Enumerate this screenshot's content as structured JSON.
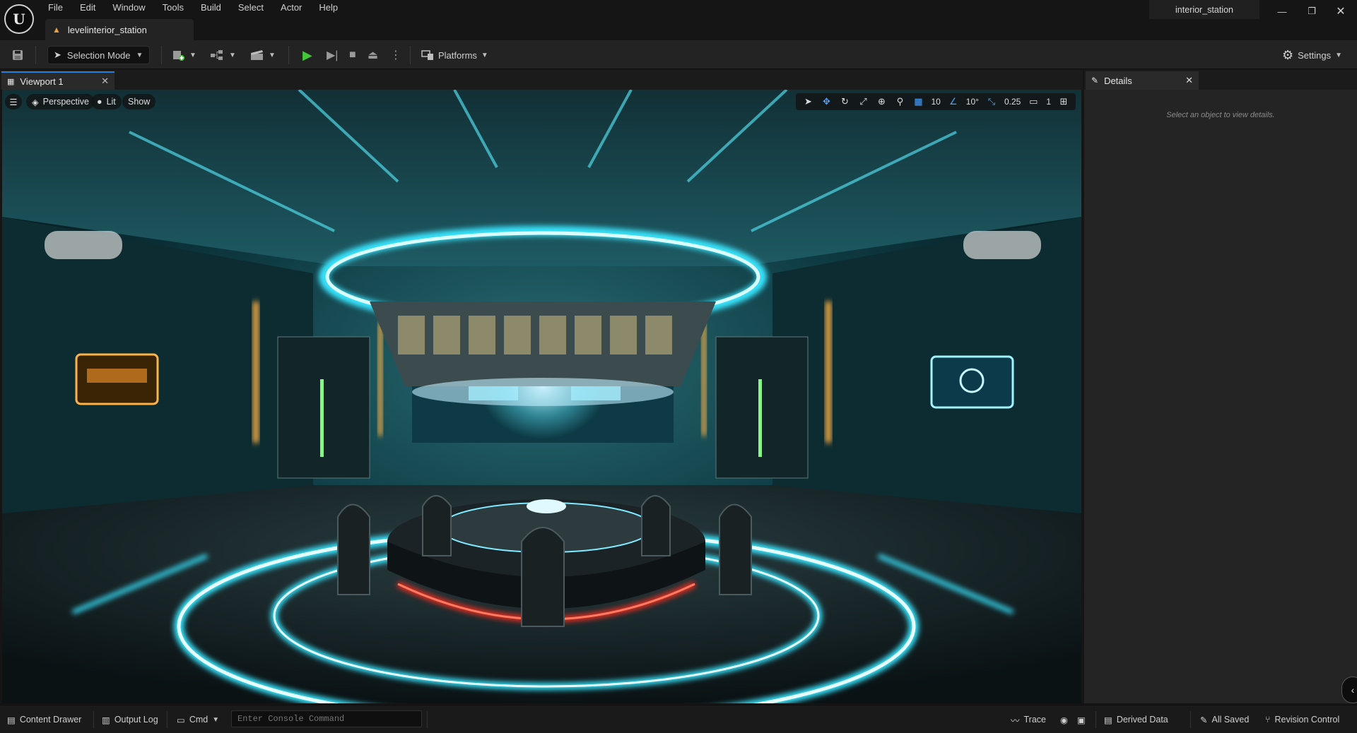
{
  "menu": {
    "items": [
      "File",
      "Edit",
      "Window",
      "Tools",
      "Build",
      "Select",
      "Actor",
      "Help"
    ]
  },
  "level_tab": {
    "label": "levelinterior_station"
  },
  "project": {
    "name": "interior_station"
  },
  "window_controls": {
    "minimize": "—",
    "restore": "❐",
    "close": "✕"
  },
  "toolbar": {
    "selection_mode": "Selection Mode",
    "platforms": "Platforms",
    "settings": "Settings"
  },
  "viewport": {
    "tab_label": "Viewport 1",
    "perspective": "Perspective",
    "lit": "Lit",
    "show": "Show",
    "grid_snap": "10",
    "rotation_snap": "10°",
    "scale_snap": "0.25",
    "camera_speed": "1"
  },
  "details": {
    "tab_label": "Details",
    "hint": "Select an object to view details."
  },
  "statusbar": {
    "content_drawer": "Content Drawer",
    "output_log": "Output Log",
    "cmd": "Cmd",
    "console_placeholder": "Enter Console Command",
    "trace": "Trace",
    "derived_data": "Derived Data",
    "all_saved": "All Saved",
    "revision_control": "Revision Control"
  },
  "colors": {
    "accent": "#2e7dd7",
    "play": "#43c43b",
    "cyan_light": "#39e6ff",
    "red_light": "#ff2a1a",
    "amber_light": "#ffb347"
  },
  "icons": [
    "unreal-logo-icon",
    "save-icon",
    "play-icon",
    "gear-icon",
    "close-icon",
    "chevron-down-icon"
  ]
}
